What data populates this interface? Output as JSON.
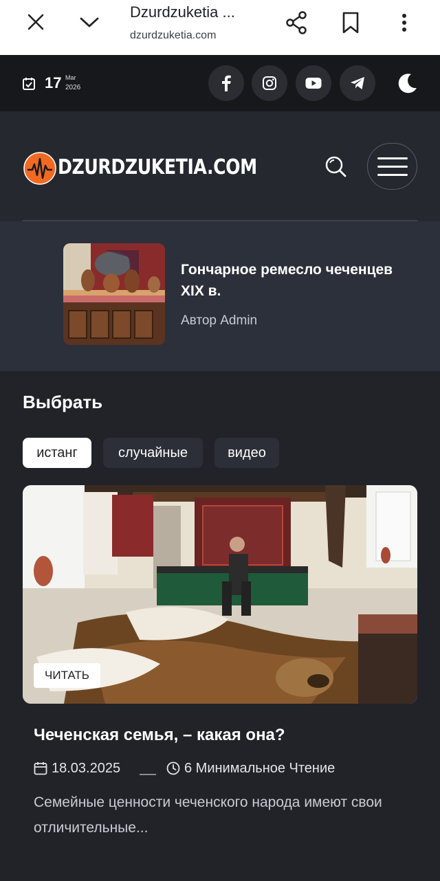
{
  "browser": {
    "title": "Dzurdzuketia ...",
    "url": "dzurdzuketia.com"
  },
  "topbar": {
    "day": "17",
    "month": "Mar",
    "year": "2026",
    "social": [
      "facebook-icon",
      "instagram-icon",
      "youtube-icon",
      "telegram-icon"
    ],
    "theme_toggle": "moon-icon"
  },
  "header": {
    "logo_text": "DZURDZUKETIA.COM",
    "logo_color": "#f26a21"
  },
  "featured": {
    "title_line1": "Гончарное ремесло чеченцев",
    "title_line2": "XIX в.",
    "author": "Автор Admin"
  },
  "section": {
    "title": "Выбрать",
    "tabs": [
      "истанг",
      "случайные",
      "видео"
    ]
  },
  "article": {
    "badge": "ЧИТАТЬ",
    "title": "Чеченская семья, – какая она?",
    "date": "18.03.2025",
    "read_time": "6 Минимальное Чтение",
    "excerpt": "Семейные ценности чеченского народа имеют свои отличительные..."
  }
}
